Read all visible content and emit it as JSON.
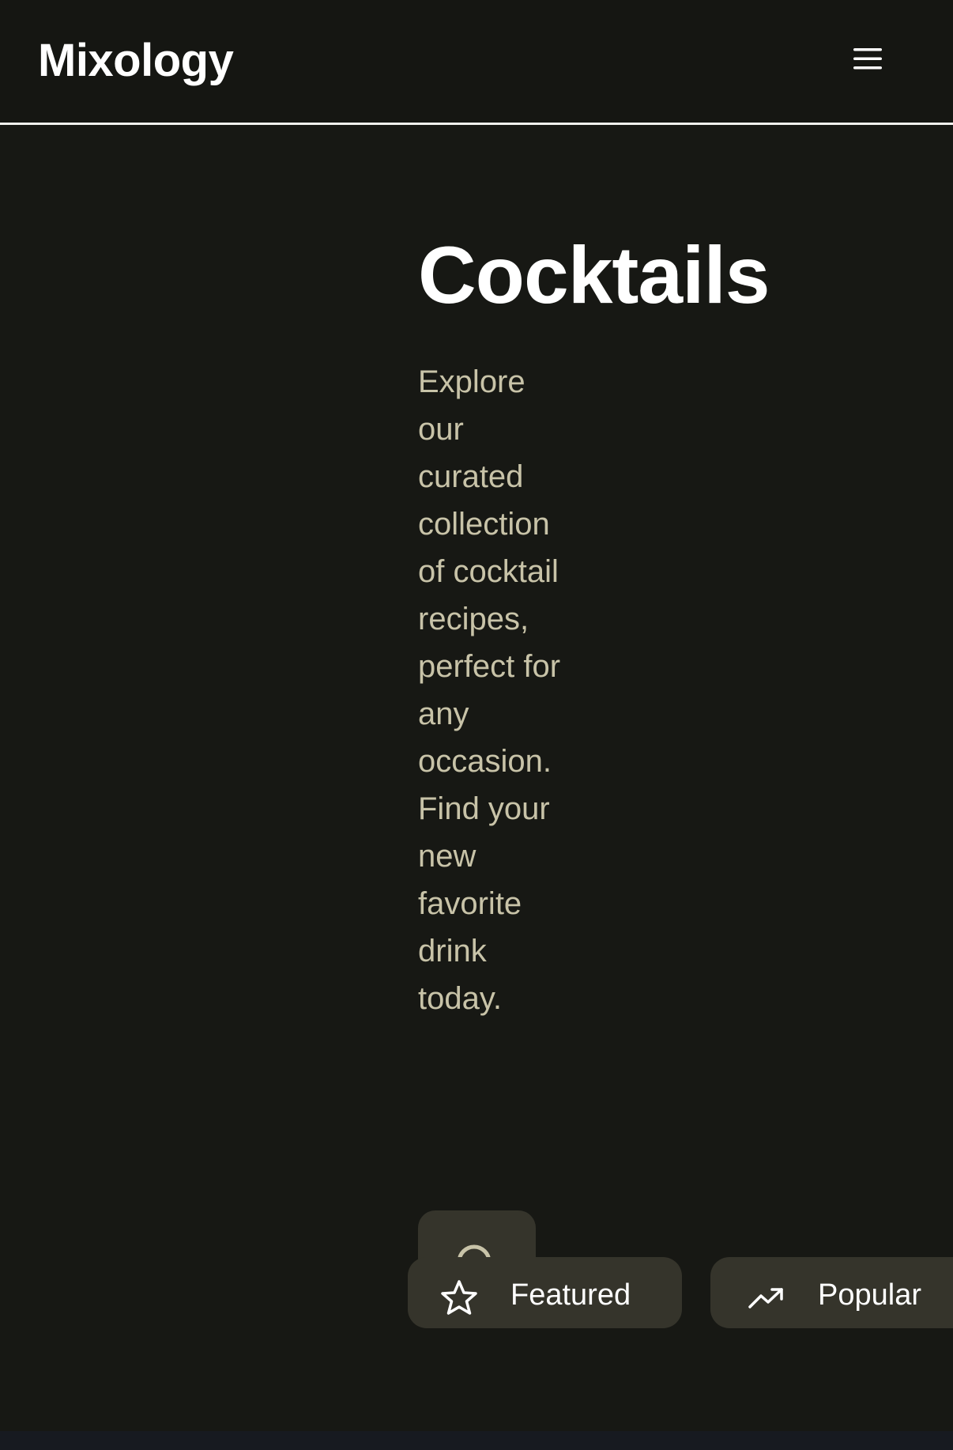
{
  "header": {
    "brand": "Mixology",
    "menu_icon": "hamburger-menu-icon"
  },
  "hero": {
    "title": "Cocktails",
    "description": "Explore our curated collection of cocktail recipes, perfect for any occasion. Find your new favorite drink today."
  },
  "search": {
    "icon": "search-icon"
  },
  "chips": [
    {
      "label": "Featured",
      "icon": "star-icon"
    },
    {
      "label": "Popular",
      "icon": "trending-up-icon"
    }
  ],
  "colors": {
    "background": "#171814",
    "accent_surface": "#35342b",
    "muted_text": "#c8c3a8",
    "text": "#ffffff"
  }
}
